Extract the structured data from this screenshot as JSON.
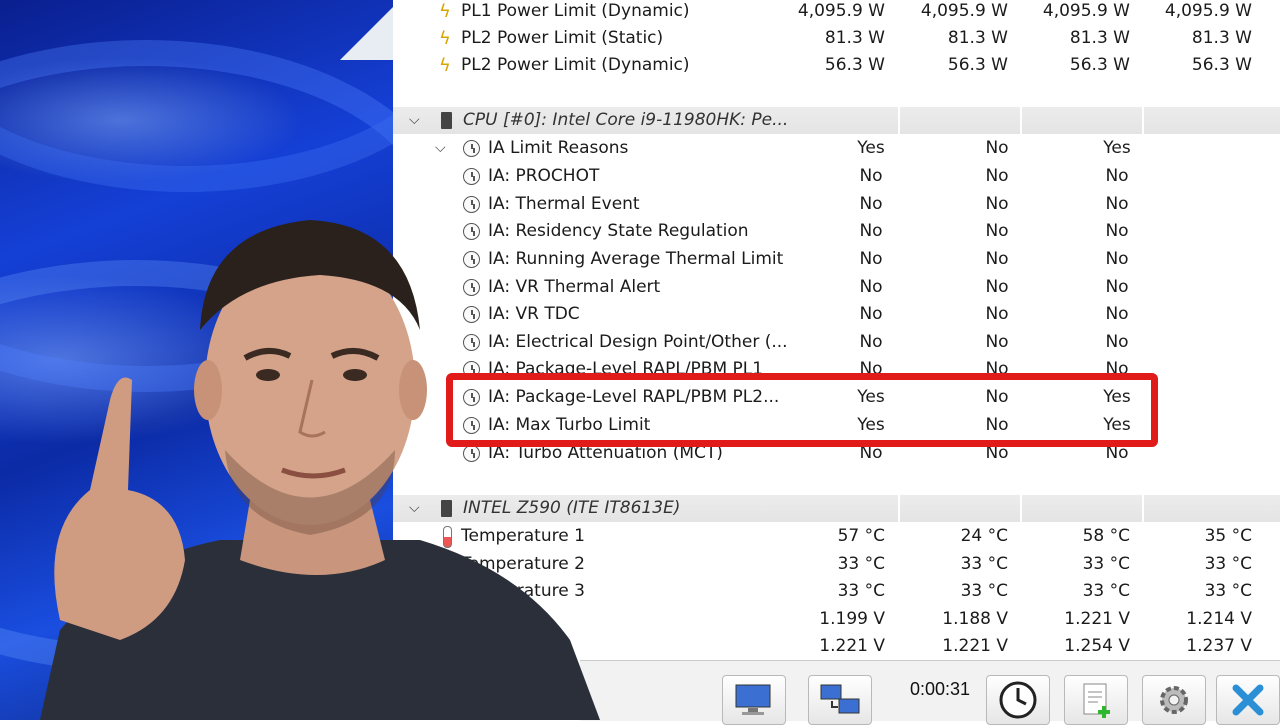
{
  "power_rows": [
    {
      "label": "PL1 Power Limit (Dynamic)",
      "values": [
        "4,095.9 W",
        "4,095.9 W",
        "4,095.9 W",
        "4,095.9 W"
      ]
    },
    {
      "label": "PL2 Power Limit (Static)",
      "values": [
        "81.3 W",
        "81.3 W",
        "81.3 W",
        "81.3 W"
      ]
    },
    {
      "label": "PL2 Power Limit (Dynamic)",
      "values": [
        "56.3 W",
        "56.3 W",
        "56.3 W",
        "56.3 W"
      ]
    }
  ],
  "cpu_group": {
    "title": "CPU [#0]: Intel Core i9-11980HK: Pe...",
    "parent": {
      "label": "IA Limit Reasons",
      "values": [
        "Yes",
        "No",
        "Yes"
      ]
    },
    "items": [
      {
        "label": "IA: PROCHOT",
        "values": [
          "No",
          "No",
          "No"
        ]
      },
      {
        "label": "IA: Thermal Event",
        "values": [
          "No",
          "No",
          "No"
        ]
      },
      {
        "label": "IA: Residency State Regulation",
        "values": [
          "No",
          "No",
          "No"
        ]
      },
      {
        "label": "IA: Running Average Thermal Limit",
        "values": [
          "No",
          "No",
          "No"
        ]
      },
      {
        "label": "IA: VR Thermal Alert",
        "values": [
          "No",
          "No",
          "No"
        ]
      },
      {
        "label": "IA: VR TDC",
        "values": [
          "No",
          "No",
          "No"
        ]
      },
      {
        "label": "IA: Electrical Design Point/Other (...",
        "values": [
          "No",
          "No",
          "No"
        ]
      },
      {
        "label": "IA: Package-Level RAPL/PBM PL1",
        "values": [
          "No",
          "No",
          "No"
        ]
      },
      {
        "label": "IA: Package-Level RAPL/PBM PL2...",
        "values": [
          "Yes",
          "No",
          "Yes"
        ]
      },
      {
        "label": "IA: Max Turbo Limit",
        "values": [
          "Yes",
          "No",
          "Yes"
        ]
      },
      {
        "label": "IA: Turbo Attenuation (MCT)",
        "values": [
          "No",
          "No",
          "No"
        ]
      }
    ]
  },
  "board_group": {
    "title": "INTEL Z590 (ITE IT8613E)",
    "items": [
      {
        "label": "Temperature 1",
        "values": [
          "57 °C",
          "24 °C",
          "58 °C",
          "35 °C"
        ]
      },
      {
        "label": "Temperature 2",
        "values": [
          "33 °C",
          "33 °C",
          "33 °C",
          "33 °C"
        ]
      },
      {
        "label": "Temperature 3",
        "values": [
          "33 °C",
          "33 °C",
          "33 °C",
          "33 °C"
        ]
      },
      {
        "label": "",
        "values": [
          "1.199 V",
          "1.188 V",
          "1.221 V",
          "1.214 V"
        ]
      },
      {
        "label": "",
        "values": [
          "1.221 V",
          "1.221 V",
          "1.254 V",
          "1.237 V"
        ]
      }
    ]
  },
  "toolbar": {
    "timer": "0:00:31",
    "buttons": [
      "network-monitor-icon",
      "network-share-icon",
      "clock-icon",
      "report-add-icon",
      "settings-gear-icon",
      "close-icon"
    ]
  },
  "colors": {
    "highlight": "#e11a1a",
    "bolt": "#d8a400",
    "group_bg": "#e8e8e8"
  }
}
